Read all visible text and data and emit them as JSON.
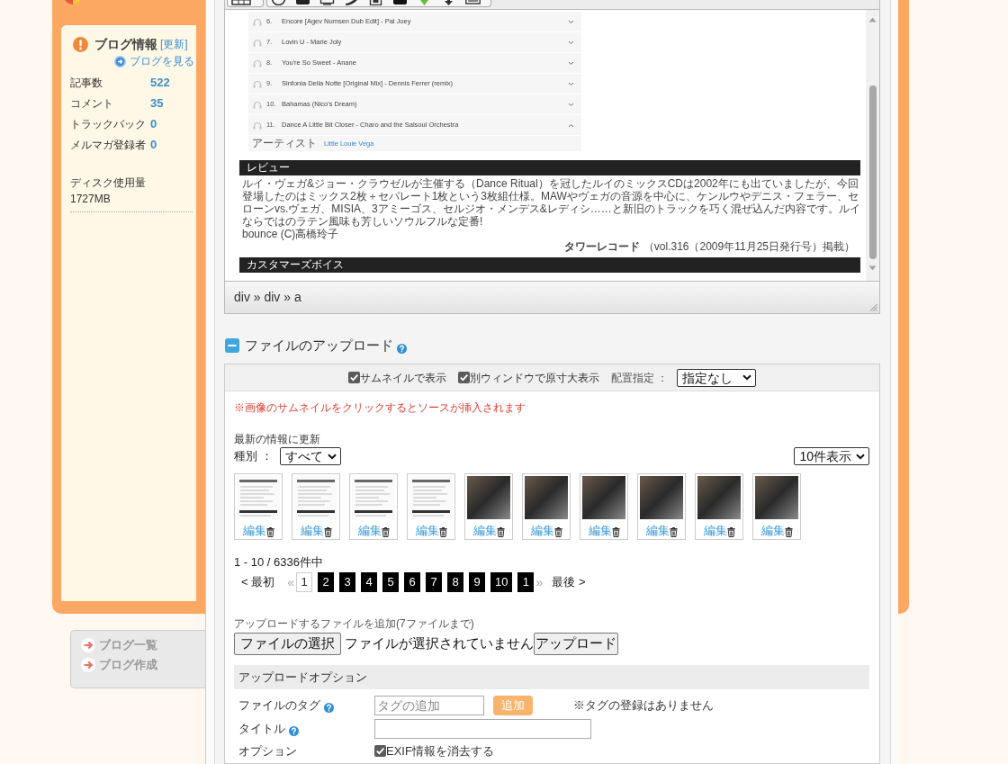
{
  "sidebar": {
    "title": "ブログ情報",
    "refresh_link": "[更新]",
    "view_link": "ブログを見る",
    "stats": [
      {
        "label": "記事数",
        "value": "522"
      },
      {
        "label": "コメント",
        "value": "35"
      },
      {
        "label": "トラックバック",
        "value": "0"
      },
      {
        "label": "メルマガ登録者",
        "value": "0"
      }
    ],
    "disk": {
      "label": "ディスク使用量",
      "value": "1727MB"
    },
    "nav": [
      {
        "label": "ブログ一覧"
      },
      {
        "label": "ブログ作成"
      }
    ]
  },
  "editor": {
    "tracks": [
      {
        "number": "6.",
        "title": "Encore [Agev Numsen Dub Edit] - Pal Joey",
        "expanded": false
      },
      {
        "number": "7.",
        "title": "Lovin U - Marie Joly",
        "expanded": false
      },
      {
        "number": "8.",
        "title": "You're So Sweet - Anane",
        "expanded": false
      },
      {
        "number": "9.",
        "title": "Sinfonia Della Notte [Original Mix] - Dennis Ferrer (remix)",
        "expanded": false
      },
      {
        "number": "10.",
        "title": "Bahamas (Nico's Dream)",
        "expanded": false
      },
      {
        "number": "11.",
        "title": "Dance A Little Bit Closer - Charo and the Salsoul Orchestra",
        "expanded": true,
        "details": [
          {
            "label": "アーティスト",
            "value": "Little Louie Vega"
          }
        ]
      }
    ],
    "review": {
      "heading": "レビュー",
      "text": "ルイ・ヴェガ&ジョー・クラウゼルが主催する（Dance Ritual）を冠したルイのミックスCDは2002年にも出ていましたが、今回登場したのはミックス2枚＋セパレート1枚という3枚組仕様。MAWやヴェガの音源を中心に、ケンルウやデニス・フェラー、セローンvs.ヴェガ、MISIA、3アミーゴス、セルジオ・メンデス&レディシ……と新旧のトラックを巧く混ぜ込んだ内容です。ルイならではのラテン風味も芳しいソウルフルな定番!",
      "credit": "bounce (C)高橋玲子",
      "source": "**タワーレコード** （vol.316（2009年11月25日発行号）掲載）"
    },
    "customer_heading": "カスタマーズボイス",
    "path": "div » div » a"
  },
  "upload": {
    "title": "ファイルのアップロード",
    "expanded": true,
    "display_options": [
      {
        "label": "サムネイルで表示",
        "checked": true
      },
      {
        "label": "別ウィンドウで原寸大表示",
        "checked": true
      }
    ],
    "placement": {
      "label": "配置指定 ：",
      "value": "指定なし"
    },
    "notice": "※画像のサムネイルをクリックするとソースが挿入されます",
    "refresh": "最新の情報に更新",
    "type_filter": {
      "label": "種別 ：",
      "value": "すべて"
    },
    "per_page": "10件表示",
    "files": [
      {
        "kind": "document",
        "edit": "編集"
      },
      {
        "kind": "document",
        "edit": "編集"
      },
      {
        "kind": "document",
        "edit": "編集"
      },
      {
        "kind": "document",
        "edit": "編集"
      },
      {
        "kind": "photo",
        "edit": "編集"
      },
      {
        "kind": "photo",
        "edit": "編集"
      },
      {
        "kind": "photo",
        "edit": "編集"
      },
      {
        "kind": "photo",
        "edit": "編集"
      },
      {
        "kind": "photo",
        "edit": "編集"
      },
      {
        "kind": "photo",
        "edit": "編集"
      }
    ],
    "count": "1 - 10 / 6336件中",
    "pagination": {
      "first": "< 最初",
      "prev": "«",
      "pages": [
        {
          "label": "1",
          "selected": true
        },
        {
          "label": "2",
          "selected": false
        },
        {
          "label": "3",
          "selected": false
        },
        {
          "label": "4",
          "selected": false
        },
        {
          "label": "5",
          "selected": false
        },
        {
          "label": "6",
          "selected": false
        },
        {
          "label": "7",
          "selected": false
        },
        {
          "label": "8",
          "selected": false
        },
        {
          "label": "9",
          "selected": false
        },
        {
          "label": "10",
          "selected": false
        },
        {
          "label": "1",
          "selected": false
        }
      ],
      "next": "»",
      "last": "最後 >"
    },
    "file_add": {
      "hint": "アップロードするファイルを追加(7ファイルまで)",
      "choose_button": "ファイルの選択",
      "no_file": "ファイルが選択されていません",
      "upload_button": "アップロード"
    },
    "options": {
      "heading": "アップロードオプション",
      "rows": [
        {
          "kind": "tag",
          "label": "ファイルのタグ",
          "placeholder": "タグの追加",
          "button": "追加",
          "note": "※タグの登録はありません"
        },
        {
          "kind": "text",
          "label": "タイトル"
        },
        {
          "kind": "checkbox",
          "label": "オプション",
          "option": "EXIF情報を消去する",
          "checked": true
        }
      ]
    }
  }
}
